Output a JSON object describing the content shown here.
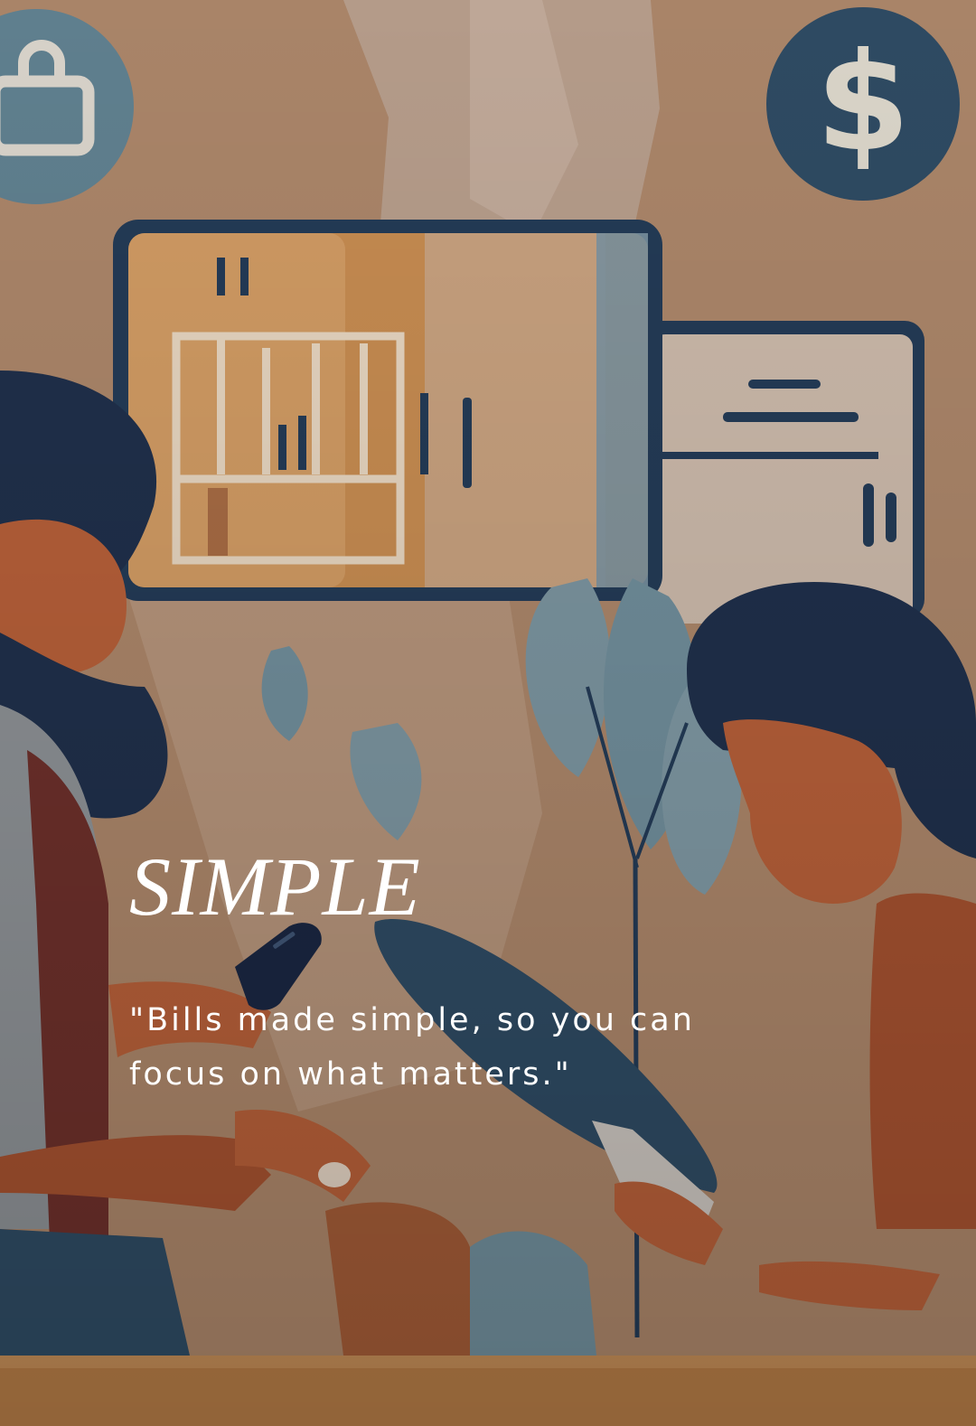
{
  "screen": {
    "headline": "SIMPLE",
    "tagline": "\"Bills made simple, so you can focus on what matters.\""
  },
  "illustration": {
    "icons": [
      "shopping-bag-icon",
      "dollar-icon",
      "bar-chart-icon",
      "smartphone-icon"
    ],
    "colors": {
      "background": "#a98468",
      "navy": "#233a55",
      "teal": "#5f7f8e",
      "orange": "#b46a40",
      "cream": "#e3d2bd"
    }
  }
}
